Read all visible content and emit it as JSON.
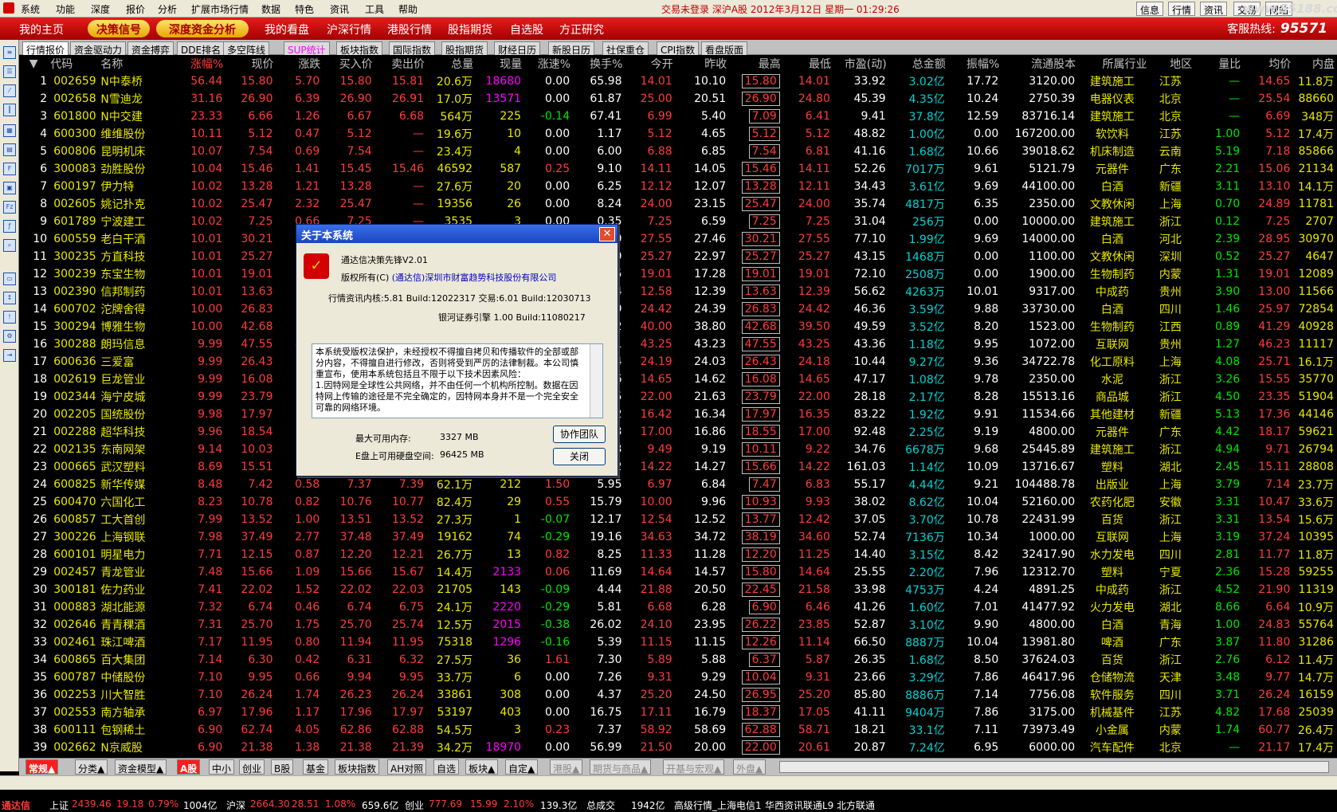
{
  "menubar": {
    "items": [
      "系统",
      "功能",
      "深度",
      "报价",
      "分析",
      "扩展市场行情",
      "数据",
      "特色",
      "资讯",
      "工具",
      "帮助"
    ],
    "status": "交易未登录 深沪A股 2012年3月12日 星期一 01:29:26",
    "right_buttons": [
      "信息",
      "行情",
      "资讯",
      "交易",
      "网站"
    ],
    "watermark": "www.55188.com"
  },
  "toolbar": {
    "items": [
      "我的主页",
      "决策信号",
      "深度资金分析",
      "我的看盘",
      "沪深行情",
      "港股行情",
      "股指期货",
      "自选股",
      "方正研究"
    ],
    "hotline_label": "客服热线:",
    "hotline_number": "95571"
  },
  "tabs": [
    "行情报价",
    "资金驱动力",
    "资金搏弈",
    "DDE排名",
    "多空阵线",
    "SUP统计",
    "板块指数",
    "国际指数",
    "股指期货",
    "财经日历",
    "新股日历",
    "社保重仓",
    "CPI指数",
    "看盘版面"
  ],
  "columns": [
    "",
    "代码",
    "名称",
    "涨幅%",
    "现价",
    "涨跌",
    "买入价",
    "卖出价",
    "总量",
    "现量",
    "涨速%",
    "换手%",
    "今开",
    "昨收",
    "最高",
    "最低",
    "市盈(动)",
    "总金额",
    "振幅%",
    "流通股本",
    "所属行业",
    "地区",
    "量比",
    "均价",
    "内盘"
  ],
  "rows": [
    [
      "1",
      "002659",
      "N中泰桥",
      "56.44",
      "15.80",
      "5.70",
      "15.80",
      "15.81",
      "20.6万",
      "18680",
      "0.00",
      "65.98",
      "14.01",
      "10.10",
      "15.80",
      "14.01",
      "33.92",
      "3.02亿",
      "17.72",
      "3120.00",
      "建筑施工",
      "江苏",
      "—",
      "14.65",
      "11.8万"
    ],
    [
      "2",
      "002658",
      "N雪迪龙",
      "31.16",
      "26.90",
      "6.39",
      "26.90",
      "26.91",
      "17.0万",
      "13571",
      "0.00",
      "61.87",
      "25.00",
      "20.51",
      "26.90",
      "24.80",
      "45.39",
      "4.35亿",
      "10.24",
      "2750.39",
      "电器仪表",
      "北京",
      "—",
      "25.54",
      "88660"
    ],
    [
      "3",
      "601800",
      "N中交建",
      "23.33",
      "6.66",
      "1.26",
      "6.67",
      "6.68",
      "564万",
      "225",
      "-0.14",
      "67.41",
      "6.99",
      "5.40",
      "7.09",
      "6.41",
      "9.41",
      "37.8亿",
      "12.59",
      "83716.14",
      "建筑施工",
      "北京",
      "—",
      "6.69",
      "348万"
    ],
    [
      "4",
      "600300",
      "维维股份",
      "10.11",
      "5.12",
      "0.47",
      "5.12",
      "—",
      "19.6万",
      "10",
      "0.00",
      "1.17",
      "5.12",
      "4.65",
      "5.12",
      "5.12",
      "48.82",
      "1.00亿",
      "0.00",
      "167200.00",
      "软饮料",
      "江苏",
      "1.00",
      "5.12",
      "17.4万"
    ],
    [
      "5",
      "600806",
      "昆明机床",
      "10.07",
      "7.54",
      "0.69",
      "7.54",
      "—",
      "23.4万",
      "4",
      "0.00",
      "6.00",
      "6.88",
      "6.85",
      "7.54",
      "6.81",
      "41.16",
      "1.68亿",
      "10.66",
      "39018.62",
      "机床制造",
      "云南",
      "5.19",
      "7.18",
      "85866"
    ],
    [
      "6",
      "300083",
      "劲胜股份",
      "10.04",
      "15.46",
      "1.41",
      "15.45",
      "15.46",
      "46592",
      "587",
      "0.25",
      "9.10",
      "14.11",
      "14.05",
      "15.46",
      "14.11",
      "52.26",
      "7017万",
      "9.61",
      "5121.79",
      "元器件",
      "广东",
      "2.21",
      "15.06",
      "21134"
    ],
    [
      "7",
      "600197",
      "伊力特",
      "10.02",
      "13.28",
      "1.21",
      "13.28",
      "—",
      "27.6万",
      "20",
      "0.00",
      "6.25",
      "12.12",
      "12.07",
      "13.28",
      "12.11",
      "34.43",
      "3.61亿",
      "9.69",
      "44100.00",
      "白酒",
      "新疆",
      "3.11",
      "13.10",
      "14.1万"
    ],
    [
      "8",
      "002605",
      "姚记扑克",
      "10.02",
      "25.47",
      "2.32",
      "25.47",
      "—",
      "19356",
      "26",
      "0.00",
      "8.24",
      "24.00",
      "23.15",
      "25.47",
      "24.00",
      "35.74",
      "4817万",
      "6.35",
      "2350.00",
      "文教休闲",
      "上海",
      "0.70",
      "24.89",
      "11781"
    ],
    [
      "9",
      "601789",
      "宁波建工",
      "10.02",
      "7.25",
      "0.66",
      "7.25",
      "—",
      "3535",
      "3",
      "0.00",
      "0.35",
      "7.25",
      "6.59",
      "7.25",
      "7.25",
      "31.04",
      "256万",
      "0.00",
      "10000.00",
      "建筑施工",
      "浙江",
      "0.12",
      "7.25",
      "2707"
    ],
    [
      "10",
      "600559",
      "老白干酒",
      "10.01",
      "30.21",
      "2.75",
      "30.21",
      "—",
      "10.3万",
      "20",
      "0.00",
      "7.39",
      "27.55",
      "27.46",
      "30.21",
      "27.55",
      "77.10",
      "1.99亿",
      "9.69",
      "14000.00",
      "白酒",
      "河北",
      "2.39",
      "28.95",
      "30970"
    ],
    [
      "11",
      "300235",
      "方直科技",
      "10.01",
      "25.27",
      "2.30",
      "25.27",
      "—",
      "5821",
      "11",
      "0.00",
      "5.29",
      "25.27",
      "22.97",
      "25.27",
      "25.27",
      "43.15",
      "1468万",
      "0.00",
      "1100.00",
      "文教休闲",
      "深圳",
      "0.52",
      "25.27",
      "4647"
    ],
    [
      "12",
      "300239",
      "东宝生物",
      "10.01",
      "19.01",
      "1.73",
      "19.01",
      "—",
      "13197",
      "45",
      "0.00",
      "6.95",
      "19.01",
      "17.28",
      "19.01",
      "19.01",
      "72.10",
      "2508万",
      "0.00",
      "1900.00",
      "生物制药",
      "内蒙",
      "1.31",
      "19.01",
      "12089"
    ],
    [
      "13",
      "002390",
      "信邦制药",
      "10.01",
      "13.63",
      "1.24",
      "13.63",
      "—",
      "18986",
      "20",
      "0.00",
      "2.04",
      "12.58",
      "12.39",
      "13.63",
      "12.39",
      "56.62",
      "4263万",
      "10.01",
      "9317.00",
      "中成药",
      "贵州",
      "3.90",
      "13.00",
      "11566"
    ],
    [
      "14",
      "600702",
      "沱牌舍得",
      "10.00",
      "26.83",
      "2.44",
      "26.83",
      "—",
      "13.8万",
      "40",
      "0.00",
      "4.09",
      "24.42",
      "24.39",
      "26.83",
      "24.42",
      "46.36",
      "3.59亿",
      "9.88",
      "33730.00",
      "白酒",
      "四川",
      "1.46",
      "25.97",
      "72854"
    ],
    [
      "15",
      "300294",
      "博雅生物",
      "10.00",
      "42.68",
      "3.88",
      "42.68",
      "—",
      "8254",
      "3",
      "0.00",
      "5.42",
      "40.00",
      "38.80",
      "42.68",
      "39.50",
      "49.59",
      "3.52亿",
      "8.20",
      "1523.00",
      "生物制药",
      "江西",
      "0.89",
      "41.29",
      "40928"
    ],
    [
      "16",
      "300288",
      "朗玛信息",
      "9.99",
      "47.55",
      "4.32",
      "47.55",
      "—",
      "25612",
      "15",
      "0.00",
      "23.81",
      "43.25",
      "43.23",
      "47.55",
      "43.25",
      "43.36",
      "1.18亿",
      "9.95",
      "1072.00",
      "互联网",
      "贵州",
      "1.27",
      "46.23",
      "11117"
    ],
    [
      "17",
      "600636",
      "三爱富",
      "9.99",
      "26.43",
      "2.40",
      "26.43",
      "—",
      "35.0万",
      "30",
      "0.00",
      "10.14",
      "24.19",
      "24.03",
      "26.43",
      "24.18",
      "10.44",
      "9.27亿",
      "9.36",
      "34722.78",
      "化工原料",
      "上海",
      "4.08",
      "25.71",
      "16.1万"
    ],
    [
      "18",
      "002619",
      "巨龙管业",
      "9.99",
      "16.08",
      "1.46",
      "16.08",
      "—",
      "67124",
      "21",
      "0.00",
      "28.56",
      "14.65",
      "14.62",
      "16.08",
      "14.65",
      "47.17",
      "1.08亿",
      "9.78",
      "2350.00",
      "水泥",
      "浙江",
      "3.26",
      "15.55",
      "35770"
    ],
    [
      "19",
      "002344",
      "海宁皮城",
      "9.99",
      "23.79",
      "2.16",
      "23.79",
      "—",
      "92247",
      "65",
      "0.00",
      "5.95",
      "22.00",
      "21.63",
      "23.79",
      "22.00",
      "28.18",
      "2.17亿",
      "8.28",
      "15513.16",
      "商品城",
      "浙江",
      "4.50",
      "23.35",
      "51904"
    ],
    [
      "20",
      "002205",
      "国统股份",
      "9.98",
      "17.97",
      "1.63",
      "17.97",
      "—",
      "11.1万",
      "20",
      "0.00",
      "9.62",
      "16.42",
      "16.34",
      "17.97",
      "16.35",
      "83.22",
      "1.92亿",
      "9.91",
      "11534.66",
      "其他建材",
      "新疆",
      "5.13",
      "17.36",
      "44146"
    ],
    [
      "21",
      "002288",
      "超华科技",
      "9.96",
      "18.54",
      "1.68",
      "18.54",
      "—",
      "12.3万",
      "10",
      "0.00",
      "25.63",
      "17.00",
      "16.86",
      "18.55",
      "17.00",
      "92.48",
      "2.25亿",
      "9.19",
      "4800.00",
      "元器件",
      "广东",
      "4.42",
      "18.17",
      "59621"
    ],
    [
      "22",
      "002135",
      "东南网架",
      "9.14",
      "10.03",
      "0.84",
      "10.02",
      "—",
      "69543",
      "39",
      "0.00",
      "2.73",
      "9.49",
      "9.19",
      "10.11",
      "9.22",
      "34.76",
      "6678万",
      "9.68",
      "25445.89",
      "建筑施工",
      "浙江",
      "4.94",
      "9.71",
      "26794"
    ],
    [
      "23",
      "000665",
      "武汉塑料",
      "8.69",
      "15.51",
      "1.24",
      "15.51",
      "—",
      "72975",
      "15",
      "0.00",
      "5.32",
      "14.22",
      "14.27",
      "15.66",
      "14.22",
      "161.03",
      "1.14亿",
      "10.09",
      "13716.67",
      "塑料",
      "湖北",
      "2.45",
      "15.11",
      "28808"
    ],
    [
      "24",
      "600825",
      "新华传媒",
      "8.48",
      "7.42",
      "0.58",
      "7.37",
      "7.39",
      "62.1万",
      "212",
      "1.50",
      "5.95",
      "6.97",
      "6.84",
      "7.47",
      "6.83",
      "55.17",
      "4.44亿",
      "9.21",
      "104488.78",
      "出版业",
      "上海",
      "3.79",
      "7.14",
      "23.7万"
    ],
    [
      "25",
      "600470",
      "六国化工",
      "8.23",
      "10.78",
      "0.82",
      "10.76",
      "10.77",
      "82.4万",
      "29",
      "0.55",
      "15.79",
      "10.00",
      "9.96",
      "10.93",
      "9.93",
      "38.02",
      "8.62亿",
      "10.04",
      "52160.00",
      "农药化肥",
      "安徽",
      "3.31",
      "10.47",
      "33.6万"
    ],
    [
      "26",
      "600857",
      "工大首创",
      "7.99",
      "13.52",
      "1.00",
      "13.51",
      "13.52",
      "27.3万",
      "1",
      "-0.07",
      "12.17",
      "12.54",
      "12.52",
      "13.77",
      "12.42",
      "37.05",
      "3.70亿",
      "10.78",
      "22431.99",
      "百货",
      "浙江",
      "3.31",
      "13.54",
      "15.6万"
    ],
    [
      "27",
      "300226",
      "上海钢联",
      "7.98",
      "37.49",
      "2.77",
      "37.48",
      "37.49",
      "19162",
      "74",
      "-0.29",
      "19.16",
      "34.63",
      "34.72",
      "38.19",
      "34.60",
      "52.74",
      "7136万",
      "10.34",
      "1000.00",
      "互联网",
      "上海",
      "3.19",
      "37.24",
      "10395"
    ],
    [
      "28",
      "600101",
      "明星电力",
      "7.71",
      "12.15",
      "0.87",
      "12.20",
      "12.21",
      "26.7万",
      "13",
      "0.82",
      "8.25",
      "11.33",
      "11.28",
      "12.20",
      "11.25",
      "14.40",
      "3.15亿",
      "8.42",
      "32417.90",
      "水力发电",
      "四川",
      "2.81",
      "11.77",
      "11.8万"
    ],
    [
      "29",
      "002457",
      "青龙管业",
      "7.48",
      "15.66",
      "1.09",
      "15.66",
      "15.67",
      "14.4万",
      "2133",
      "0.06",
      "11.69",
      "14.64",
      "14.57",
      "15.80",
      "14.64",
      "25.55",
      "2.20亿",
      "7.96",
      "12312.70",
      "塑料",
      "宁夏",
      "2.36",
      "15.28",
      "59255"
    ],
    [
      "30",
      "300181",
      "佐力药业",
      "7.41",
      "22.02",
      "1.52",
      "22.02",
      "22.03",
      "21705",
      "143",
      "-0.09",
      "4.44",
      "21.88",
      "20.50",
      "22.45",
      "21.58",
      "33.98",
      "4753万",
      "4.24",
      "4891.25",
      "中成药",
      "浙江",
      "4.52",
      "21.90",
      "11319"
    ],
    [
      "31",
      "000883",
      "湖北能源",
      "7.32",
      "6.74",
      "0.46",
      "6.74",
      "6.75",
      "24.1万",
      "2220",
      "-0.29",
      "5.81",
      "6.68",
      "6.28",
      "6.90",
      "6.46",
      "41.26",
      "1.60亿",
      "7.01",
      "41477.92",
      "火力发电",
      "湖北",
      "8.66",
      "6.64",
      "10.9万"
    ],
    [
      "32",
      "002646",
      "青青稞酒",
      "7.31",
      "25.70",
      "1.75",
      "25.70",
      "25.74",
      "12.5万",
      "2015",
      "-0.38",
      "26.02",
      "24.10",
      "23.95",
      "26.22",
      "23.85",
      "52.87",
      "3.10亿",
      "9.90",
      "4800.00",
      "白酒",
      "青海",
      "1.00",
      "24.83",
      "55764"
    ],
    [
      "33",
      "002461",
      "珠江啤酒",
      "7.17",
      "11.95",
      "0.80",
      "11.94",
      "11.95",
      "75318",
      "1296",
      "-0.16",
      "5.39",
      "11.15",
      "11.15",
      "12.26",
      "11.14",
      "66.50",
      "8887万",
      "10.04",
      "13981.80",
      "啤酒",
      "广东",
      "3.87",
      "11.80",
      "31286"
    ],
    [
      "34",
      "600865",
      "百大集团",
      "7.14",
      "6.30",
      "0.42",
      "6.31",
      "6.32",
      "27.5万",
      "36",
      "1.61",
      "7.30",
      "5.89",
      "5.88",
      "6.37",
      "5.87",
      "26.35",
      "1.68亿",
      "8.50",
      "37624.03",
      "百货",
      "浙江",
      "2.76",
      "6.12",
      "11.4万"
    ],
    [
      "35",
      "600787",
      "中储股份",
      "7.10",
      "9.95",
      "0.66",
      "9.94",
      "9.95",
      "33.7万",
      "6",
      "0.00",
      "7.26",
      "9.31",
      "9.29",
      "10.04",
      "9.31",
      "23.66",
      "3.29亿",
      "7.86",
      "46417.96",
      "仓储物流",
      "天津",
      "3.48",
      "9.77",
      "14.7万"
    ],
    [
      "36",
      "002253",
      "川大智胜",
      "7.10",
      "26.24",
      "1.74",
      "26.23",
      "26.24",
      "33861",
      "308",
      "0.00",
      "4.37",
      "25.20",
      "24.50",
      "26.95",
      "25.20",
      "85.80",
      "8886万",
      "7.14",
      "7756.08",
      "软件服务",
      "四川",
      "3.71",
      "26.24",
      "16159"
    ],
    [
      "37",
      "002553",
      "南方轴承",
      "6.97",
      "17.96",
      "1.17",
      "17.96",
      "17.97",
      "53197",
      "403",
      "0.00",
      "16.75",
      "17.11",
      "16.79",
      "18.37",
      "17.05",
      "41.11",
      "9404万",
      "7.86",
      "3175.00",
      "机械基件",
      "江苏",
      "4.82",
      "17.68",
      "25039"
    ],
    [
      "38",
      "600111",
      "包钢稀土",
      "6.90",
      "62.74",
      "4.05",
      "62.86",
      "62.88",
      "54.5万",
      "3",
      "0.23",
      "7.37",
      "58.92",
      "58.69",
      "62.88",
      "58.71",
      "18.21",
      "33.1亿",
      "7.11",
      "73973.49",
      "小金属",
      "内蒙",
      "1.74",
      "60.77",
      "26.4万"
    ],
    [
      "39",
      "002662",
      "N京威股",
      "6.90",
      "21.38",
      "1.38",
      "21.38",
      "21.39",
      "34.2万",
      "18970",
      "0.00",
      "56.99",
      "21.50",
      "20.00",
      "22.00",
      "20.61",
      "20.87",
      "7.24亿",
      "6.95",
      "6000.00",
      "汽车配件",
      "北京",
      "—",
      "21.17",
      "17.4万"
    ]
  ],
  "dialog": {
    "title": "关于本系统",
    "close_glyph": "✕",
    "product": "通达信决策先锋V2.01",
    "copyright_label": "版权所有(C)",
    "company": "(通达信)深圳市财富趋势科技股份有限公司",
    "build1": "行情资讯内核:5.81 Build:12022317 交易:6.01 Build:12030713",
    "build2": "银河证券引擎 1.00 Build:11080217",
    "notice": "本系统受版权法保护，未经授权不得擅自拷贝和传播软件的全部或部分内容，不得擅自进行修改，否则将受到严厉的法律制裁。本公司慎重宣布，使用本系统包括且不限于以下技术因素风险：\n1.因特网是全球性公共网络，并不由任何一个机构所控制。数据在因特网上传输的途径是不完全确定的，因特网本身并不是一个完全安全可靠的网络环境。",
    "memory_label": "最大可用内存:",
    "memory_value": "3327 MB",
    "disk_label": "E盘上可用硬盘空间:",
    "disk_value": "96425 MB",
    "btn_team": "协作团队",
    "btn_close": "关闭"
  },
  "bottom_tabs": [
    "常规▲",
    "分类▲",
    "资金模型▲",
    "A股",
    "中小",
    "创业",
    "B股",
    "基金",
    "板块指数",
    "AH对照",
    "自选",
    "板块▲",
    "自定▲",
    "港股▲",
    "期货与商品▲",
    "开基与宏观▲",
    "外盘▲"
  ],
  "ticker": {
    "brand": "通达信",
    "sh_label": "上证",
    "sh_val": "2439.46",
    "sh_chg": "19.18",
    "sh_pct": "0.79%",
    "sh_amt": "1004亿",
    "sz_label": "沪深",
    "sz_val": "2664.30",
    "sz_chg": "28.51",
    "sz_pct": "1.08%",
    "sz_amt": "659.6亿",
    "cy_label": "创业",
    "cy_val": "777.69",
    "cy_chg": "15.99",
    "cy_pct": "2.10%",
    "cy_amt": "139.3亿",
    "total_label": "总成交",
    "total_val": "1942亿",
    "server": "高级行情_上海电信1",
    "server2": "华西资讯联通L9",
    "server3": "北方联通"
  },
  "colors": {
    "up": "#ff3c3c",
    "down": "#00e600",
    "brand": "#d40000"
  }
}
